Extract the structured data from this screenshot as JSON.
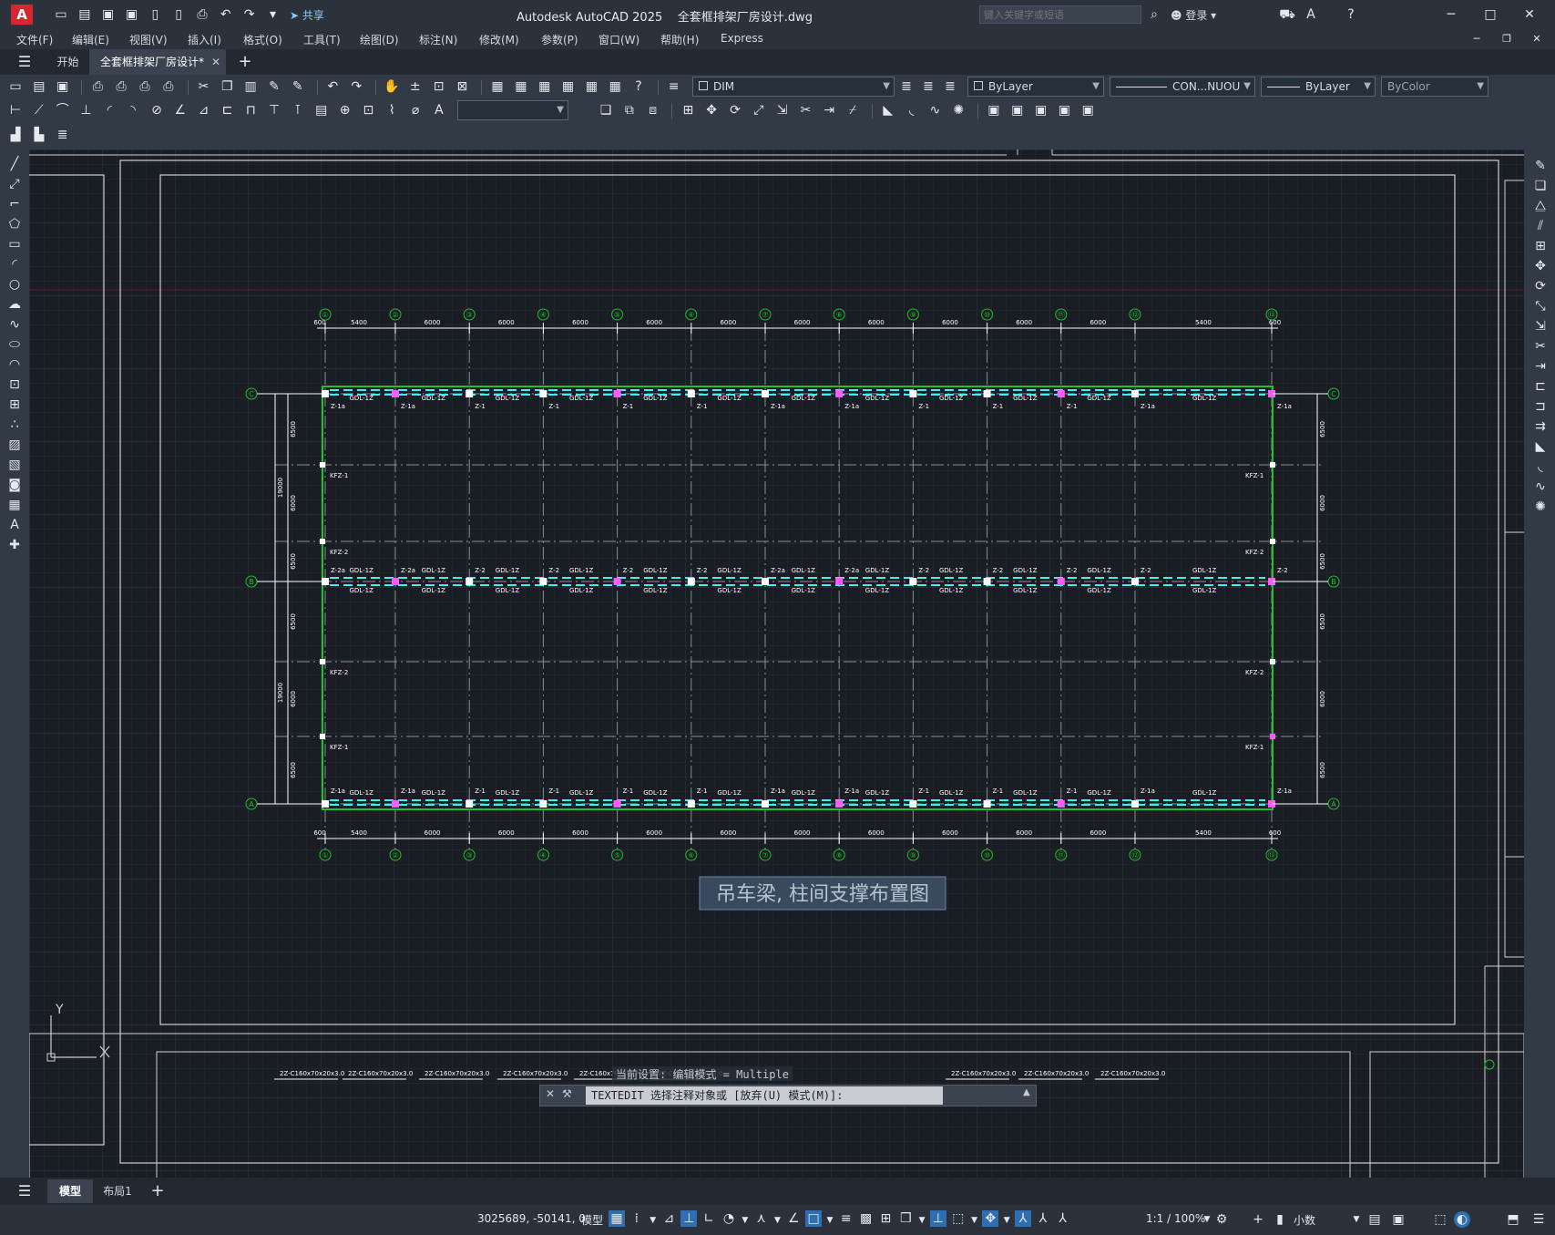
{
  "app": {
    "title": "Autodesk AutoCAD 2025",
    "filename": "全套框排架厂房设计.dwg",
    "share_label": "共享",
    "search_placeholder": "键入关键字或短语",
    "login_label": "登录"
  },
  "menu": [
    "文件(F)",
    "编辑(E)",
    "视图(V)",
    "插入(I)",
    "格式(O)",
    "工具(T)",
    "绘图(D)",
    "标注(N)",
    "修改(M)",
    "参数(P)",
    "窗口(W)",
    "帮助(H)",
    "Express"
  ],
  "tabs": {
    "start": "开始",
    "document": "全套框排架厂房设计*"
  },
  "properties": {
    "layer": "DIM",
    "color": "ByLayer",
    "linetype": "CON...NUOU",
    "lineweight": "ByLayer",
    "plotstyle": "ByColor"
  },
  "drawing": {
    "title": "吊车梁, 柱间支撑布置图",
    "top_grid": [
      "①",
      "②",
      "③",
      "④",
      "⑤",
      "⑥",
      "⑦",
      "⑧",
      "⑨",
      "⑩",
      "⑪",
      "⑫",
      "⑬"
    ],
    "bottom_grid": [
      "①",
      "②",
      "③",
      "④",
      "⑤",
      "⑥",
      "⑦",
      "⑧",
      "⑨",
      "⑩",
      "⑪",
      "⑫",
      "⑬"
    ],
    "row_axes": [
      "C",
      "B",
      "A"
    ],
    "top_dims": [
      "600",
      "5400",
      "6000",
      "6000",
      "6000",
      "6000",
      "6000",
      "6000",
      "6000",
      "6000",
      "6000",
      "6000",
      "5400",
      "600"
    ],
    "bottom_dims": [
      "600",
      "5400",
      "6000",
      "6000",
      "6000",
      "6000",
      "6000",
      "6000",
      "6000",
      "6000",
      "6000",
      "6000",
      "5400",
      "600"
    ],
    "left_dims": [
      "6500",
      "6000",
      "6500",
      "6500",
      "6000",
      "6500"
    ],
    "left_totals": [
      "19000",
      "19000"
    ],
    "right_dims": [
      "6500",
      "6000",
      "6500",
      "6500",
      "6000",
      "6500"
    ],
    "beam_label": "GDL-1Z",
    "column_labels_top": [
      "Z-1a",
      "Z-1a",
      "Z-1",
      "Z-1",
      "Z-1",
      "Z-1",
      "Z-1a",
      "Z-1a",
      "Z-1",
      "Z-1",
      "Z-1",
      "Z-1a",
      "Z-1a"
    ],
    "column_labels_mid": [
      "Z-2a",
      "Z-2a",
      "Z-2",
      "Z-2",
      "Z-2",
      "Z-2",
      "Z-2a",
      "Z-2a",
      "Z-2",
      "Z-2",
      "Z-2",
      "Z-2",
      "Z-2"
    ],
    "kfz_left": [
      "KFZ-1",
      "KFZ-2",
      "KFZ-2",
      "KFZ-1"
    ],
    "kfz_right": [
      "KFZ-1",
      "KFZ-2",
      "KFZ-2",
      "KFZ-1"
    ],
    "bottom_strip_labels": [
      "2Z-C160x70x20x3.0",
      "2Z-C160x70x20x3.0",
      "2Z-C160x70x20x3.0",
      "2Z-C160x70x20x3.0",
      "2Z-C160x70x20x3.0",
      "2Z-C160x70x20x3.0",
      "2Z-C160x70x20x3.0",
      "2Z-C160x70x20x3.0",
      "2Z-C160x70x20x3.0"
    ],
    "ucs_y": "Y"
  },
  "command": {
    "setting": "当前设置: 编辑模式 = Multiple",
    "prompt": "TEXTEDIT 选择注释对象或 [放弃(U) 模式(M)]:"
  },
  "layouts": {
    "model": "模型",
    "layout1": "布局1"
  },
  "status": {
    "coords": "3025689, -50141, 0",
    "model": "模型",
    "scale": "1:1 / 100%",
    "units": "小数"
  },
  "colors": {
    "accent_green": "#22c02c",
    "dim_cyan": "#3ff0f0",
    "magenta": "#ff5cff",
    "canvas_bg": "#1a1d23",
    "autocad_red": "#d7262e"
  }
}
